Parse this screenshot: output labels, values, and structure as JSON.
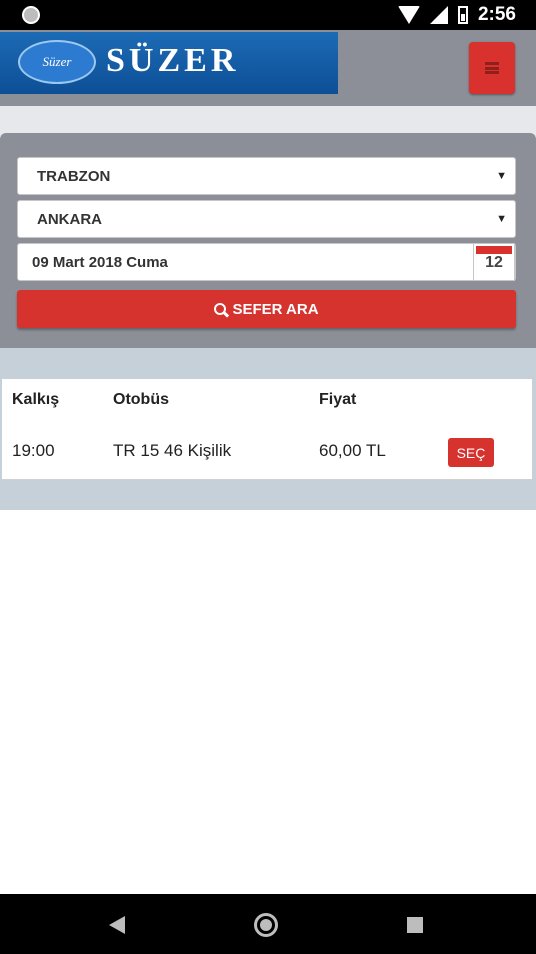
{
  "status_bar": {
    "time": "2:56"
  },
  "header": {
    "logo_script": "Süzer",
    "logo_text": "SÜZER",
    "menu_icon": "hamburger-menu-icon"
  },
  "search": {
    "from": "TRABZON",
    "to": "ANKARA",
    "date": "09 Mart 2018 Cuma",
    "calendar_day": "12",
    "button_label": "SEFER ARA"
  },
  "results": {
    "headers": {
      "departure": "Kalkış",
      "bus": "Otobüs",
      "price": "Fiyat"
    },
    "rows": [
      {
        "departure": "19:00",
        "bus": "TR 15 46 Kişilik",
        "price": "60,00 TL",
        "action": "SEÇ"
      }
    ]
  },
  "colors": {
    "accent": "#d6322e",
    "header_bg": "#8c8f97",
    "logo_bg": "#0d4f96"
  }
}
